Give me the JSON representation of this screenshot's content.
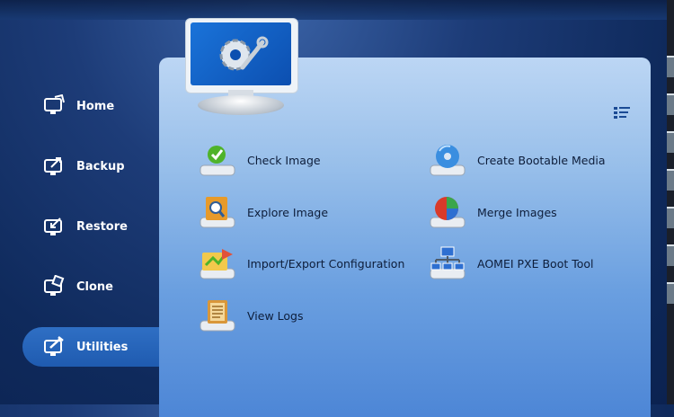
{
  "sidebar": {
    "items": [
      {
        "label": "Home",
        "icon": "home-icon"
      },
      {
        "label": "Backup",
        "icon": "backup-icon"
      },
      {
        "label": "Restore",
        "icon": "restore-icon"
      },
      {
        "label": "Clone",
        "icon": "clone-icon"
      },
      {
        "label": "Utilities",
        "icon": "utilities-icon",
        "active": true
      }
    ]
  },
  "main": {
    "header_icon": "utilities-monitor-icon",
    "view_toggle_icon": "list-view-icon",
    "tools": [
      {
        "label": "Check Image",
        "icon": "check-image-icon"
      },
      {
        "label": "Create Bootable Media",
        "icon": "bootable-media-icon"
      },
      {
        "label": "Explore Image",
        "icon": "explore-image-icon"
      },
      {
        "label": "Merge Images",
        "icon": "merge-images-icon"
      },
      {
        "label": "Import/Export Configuration",
        "icon": "import-export-icon"
      },
      {
        "label": "AOMEI PXE Boot Tool",
        "icon": "pxe-boot-icon"
      },
      {
        "label": "View Logs",
        "icon": "view-logs-icon"
      }
    ]
  },
  "colors": {
    "background": "#1d3c78",
    "panel_top": "#bcd6f4",
    "panel_bottom": "#4d86d6",
    "active_nav": "#2f6fc4"
  }
}
